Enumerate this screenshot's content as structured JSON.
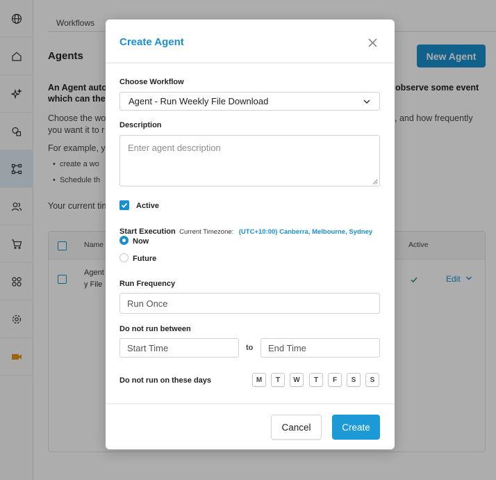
{
  "sidebar": {
    "items": [
      {
        "icon": "globe-icon"
      },
      {
        "icon": "home-icon"
      },
      {
        "icon": "sparkle-icon"
      },
      {
        "icon": "shapes-icon"
      },
      {
        "icon": "workflow-icon"
      },
      {
        "icon": "users-icon"
      },
      {
        "icon": "cart-icon"
      },
      {
        "icon": "grid-icon"
      },
      {
        "icon": "gear-icon"
      },
      {
        "icon": "video-icon"
      }
    ],
    "active_index": 4,
    "accent_color": "#e8950c"
  },
  "background": {
    "tab_label": "Workflows",
    "page_title": "Agents",
    "new_agent_label": "New Agent",
    "intro_left_1": "An Agent auto",
    "intro_left_2": "which can the",
    "intro_right": "observe some event",
    "choose_left_1": "Choose the wo",
    "choose_left_2": "you want it to r",
    "choose_right": ", and how frequently",
    "example": "For example, y",
    "bullet_1": "create a wo",
    "bullet_2": "Schedule th",
    "timezone_prefix": "Your current tin",
    "table": {
      "col_name": "Name",
      "col_active": "Active",
      "row_name_1": "Agent",
      "row_name_2": "y File",
      "edit_label": "Edit"
    }
  },
  "modal": {
    "title": "Create Agent",
    "workflow_label": "Choose Workflow",
    "workflow_value": "Agent - Run Weekly File Download",
    "description_label": "Description",
    "description_placeholder": "Enter agent description",
    "active_label": "Active",
    "active_checked": true,
    "start_execution_label": "Start Execution",
    "timezone_label": "Current Timezone:",
    "timezone_value": "(UTC+10:00) Canberra, Melbourne, Sydney",
    "radio_now": "Now",
    "radio_future": "Future",
    "selected_start": "Now",
    "run_frequency_label": "Run Frequency",
    "run_frequency_value": "Run Once",
    "do_not_run_between_label": "Do not run between",
    "start_time_placeholder": "Start Time",
    "to_label": "to",
    "end_time_placeholder": "End Time",
    "days_label": "Do not run on these days",
    "days": [
      "M",
      "T",
      "W",
      "T",
      "F",
      "S",
      "S"
    ],
    "cancel_label": "Cancel",
    "create_label": "Create",
    "accent_color": "#1a8fd0"
  }
}
